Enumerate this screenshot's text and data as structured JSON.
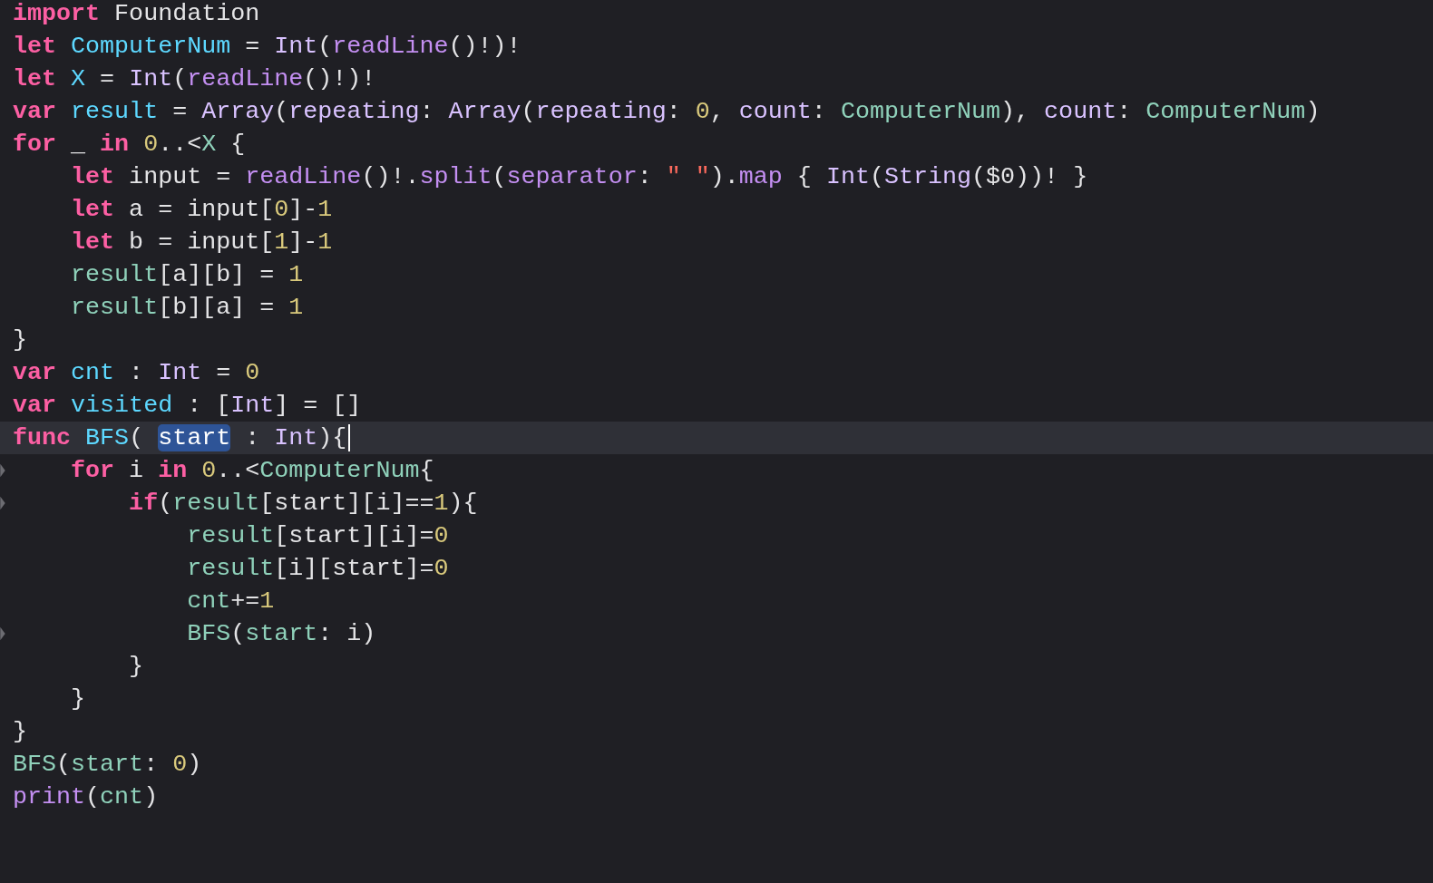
{
  "editor": {
    "lines": [
      {
        "current": false,
        "cursor": false,
        "fold_marker": false,
        "tokens": [
          {
            "kind": "keyword",
            "text": "import"
          },
          {
            "kind": "plain",
            "text": " Foundation"
          }
        ]
      },
      {
        "current": false,
        "cursor": false,
        "fold_marker": false,
        "tokens": [
          {
            "kind": "keyword",
            "text": "let"
          },
          {
            "kind": "decl",
            "text": " ComputerNum"
          },
          {
            "kind": "plain",
            "text": " = "
          },
          {
            "kind": "type",
            "text": "Int"
          },
          {
            "kind": "plain",
            "text": "("
          },
          {
            "kind": "system",
            "text": "readLine"
          },
          {
            "kind": "plain",
            "text": "()!)!"
          }
        ]
      },
      {
        "current": false,
        "cursor": false,
        "fold_marker": false,
        "tokens": [
          {
            "kind": "keyword",
            "text": "let"
          },
          {
            "kind": "decl",
            "text": " X"
          },
          {
            "kind": "plain",
            "text": " = "
          },
          {
            "kind": "type",
            "text": "Int"
          },
          {
            "kind": "plain",
            "text": "("
          },
          {
            "kind": "system",
            "text": "readLine"
          },
          {
            "kind": "plain",
            "text": "()!)!"
          }
        ]
      },
      {
        "current": false,
        "cursor": false,
        "fold_marker": false,
        "tokens": [
          {
            "kind": "keyword",
            "text": "var"
          },
          {
            "kind": "decl",
            "text": " result"
          },
          {
            "kind": "plain",
            "text": " = "
          },
          {
            "kind": "type",
            "text": "Array"
          },
          {
            "kind": "plain",
            "text": "("
          },
          {
            "kind": "type",
            "text": "repeating"
          },
          {
            "kind": "plain",
            "text": ": "
          },
          {
            "kind": "type",
            "text": "Array"
          },
          {
            "kind": "plain",
            "text": "("
          },
          {
            "kind": "type",
            "text": "repeating"
          },
          {
            "kind": "plain",
            "text": ": "
          },
          {
            "kind": "number",
            "text": "0"
          },
          {
            "kind": "plain",
            "text": ", "
          },
          {
            "kind": "type",
            "text": "count"
          },
          {
            "kind": "plain",
            "text": ": "
          },
          {
            "kind": "project",
            "text": "ComputerNum"
          },
          {
            "kind": "plain",
            "text": "), "
          },
          {
            "kind": "type",
            "text": "count"
          },
          {
            "kind": "plain",
            "text": ": "
          },
          {
            "kind": "project",
            "text": "ComputerNum"
          },
          {
            "kind": "plain",
            "text": ")"
          }
        ]
      },
      {
        "current": false,
        "cursor": false,
        "fold_marker": false,
        "tokens": [
          {
            "kind": "keyword",
            "text": "for"
          },
          {
            "kind": "plain",
            "text": " _ "
          },
          {
            "kind": "keyword",
            "text": "in"
          },
          {
            "kind": "number",
            "text": " 0"
          },
          {
            "kind": "plain",
            "text": "..<"
          },
          {
            "kind": "project",
            "text": "X"
          },
          {
            "kind": "plain",
            "text": " {"
          }
        ]
      },
      {
        "current": false,
        "cursor": false,
        "fold_marker": false,
        "tokens": [
          {
            "kind": "keyword",
            "text": "    let"
          },
          {
            "kind": "plain",
            "text": " input = "
          },
          {
            "kind": "system",
            "text": "readLine"
          },
          {
            "kind": "plain",
            "text": "()!."
          },
          {
            "kind": "system",
            "text": "split"
          },
          {
            "kind": "plain",
            "text": "("
          },
          {
            "kind": "system",
            "text": "separator"
          },
          {
            "kind": "plain",
            "text": ": "
          },
          {
            "kind": "string",
            "text": "\" \""
          },
          {
            "kind": "plain",
            "text": ")."
          },
          {
            "kind": "system",
            "text": "map"
          },
          {
            "kind": "plain",
            "text": " { "
          },
          {
            "kind": "type",
            "text": "Int"
          },
          {
            "kind": "plain",
            "text": "("
          },
          {
            "kind": "type",
            "text": "String"
          },
          {
            "kind": "plain",
            "text": "($0))! }"
          }
        ]
      },
      {
        "current": false,
        "cursor": false,
        "fold_marker": false,
        "tokens": [
          {
            "kind": "keyword",
            "text": "    let"
          },
          {
            "kind": "plain",
            "text": " a = input["
          },
          {
            "kind": "number",
            "text": "0"
          },
          {
            "kind": "plain",
            "text": "]-"
          },
          {
            "kind": "number",
            "text": "1"
          }
        ]
      },
      {
        "current": false,
        "cursor": false,
        "fold_marker": false,
        "tokens": [
          {
            "kind": "keyword",
            "text": "    let"
          },
          {
            "kind": "plain",
            "text": " b = input["
          },
          {
            "kind": "number",
            "text": "1"
          },
          {
            "kind": "plain",
            "text": "]-"
          },
          {
            "kind": "number",
            "text": "1"
          }
        ]
      },
      {
        "current": false,
        "cursor": false,
        "fold_marker": false,
        "tokens": [
          {
            "kind": "project",
            "text": "    result"
          },
          {
            "kind": "plain",
            "text": "[a][b] = "
          },
          {
            "kind": "number",
            "text": "1"
          }
        ]
      },
      {
        "current": false,
        "cursor": false,
        "fold_marker": false,
        "tokens": [
          {
            "kind": "project",
            "text": "    result"
          },
          {
            "kind": "plain",
            "text": "[b][a] = "
          },
          {
            "kind": "number",
            "text": "1"
          }
        ]
      },
      {
        "current": false,
        "cursor": false,
        "fold_marker": false,
        "tokens": [
          {
            "kind": "plain",
            "text": "}"
          }
        ]
      },
      {
        "current": false,
        "cursor": false,
        "fold_marker": false,
        "tokens": [
          {
            "kind": "keyword",
            "text": "var"
          },
          {
            "kind": "decl",
            "text": " cnt"
          },
          {
            "kind": "plain",
            "text": " : "
          },
          {
            "kind": "type",
            "text": "Int"
          },
          {
            "kind": "plain",
            "text": " = "
          },
          {
            "kind": "number",
            "text": "0"
          }
        ]
      },
      {
        "current": false,
        "cursor": false,
        "fold_marker": false,
        "tokens": [
          {
            "kind": "keyword",
            "text": "var"
          },
          {
            "kind": "decl",
            "text": " visited"
          },
          {
            "kind": "plain",
            "text": " : ["
          },
          {
            "kind": "type",
            "text": "Int"
          },
          {
            "kind": "plain",
            "text": "] = []"
          }
        ]
      },
      {
        "current": true,
        "cursor": true,
        "fold_marker": false,
        "tokens": [
          {
            "kind": "keyword",
            "text": "func"
          },
          {
            "kind": "decl",
            "text": " BFS"
          },
          {
            "kind": "plain",
            "text": "( "
          },
          {
            "kind": "highlighted",
            "text": "start"
          },
          {
            "kind": "plain",
            "text": " : "
          },
          {
            "kind": "type",
            "text": "Int"
          },
          {
            "kind": "plain",
            "text": "){"
          }
        ]
      },
      {
        "current": false,
        "cursor": false,
        "fold_marker": true,
        "tokens": [
          {
            "kind": "keyword",
            "text": "    for"
          },
          {
            "kind": "plain",
            "text": " i "
          },
          {
            "kind": "keyword",
            "text": "in"
          },
          {
            "kind": "number",
            "text": " 0"
          },
          {
            "kind": "plain",
            "text": "..<"
          },
          {
            "kind": "project",
            "text": "ComputerNum"
          },
          {
            "kind": "plain",
            "text": "{"
          }
        ]
      },
      {
        "current": false,
        "cursor": false,
        "fold_marker": true,
        "tokens": [
          {
            "kind": "keyword",
            "text": "        if"
          },
          {
            "kind": "plain",
            "text": "("
          },
          {
            "kind": "project",
            "text": "result"
          },
          {
            "kind": "plain",
            "text": "[start][i]=="
          },
          {
            "kind": "number",
            "text": "1"
          },
          {
            "kind": "plain",
            "text": "){"
          }
        ]
      },
      {
        "current": false,
        "cursor": false,
        "fold_marker": false,
        "tokens": [
          {
            "kind": "project",
            "text": "            result"
          },
          {
            "kind": "plain",
            "text": "[start][i]="
          },
          {
            "kind": "number",
            "text": "0"
          }
        ]
      },
      {
        "current": false,
        "cursor": false,
        "fold_marker": false,
        "tokens": [
          {
            "kind": "project",
            "text": "            result"
          },
          {
            "kind": "plain",
            "text": "[i][start]="
          },
          {
            "kind": "number",
            "text": "0"
          }
        ]
      },
      {
        "current": false,
        "cursor": false,
        "fold_marker": false,
        "tokens": [
          {
            "kind": "project",
            "text": "            cnt"
          },
          {
            "kind": "plain",
            "text": "+="
          },
          {
            "kind": "number",
            "text": "1"
          }
        ]
      },
      {
        "current": false,
        "cursor": false,
        "fold_marker": true,
        "tokens": [
          {
            "kind": "project",
            "text": "            BFS"
          },
          {
            "kind": "plain",
            "text": "("
          },
          {
            "kind": "project",
            "text": "start"
          },
          {
            "kind": "plain",
            "text": ": i)"
          }
        ]
      },
      {
        "current": false,
        "cursor": false,
        "fold_marker": false,
        "tokens": [
          {
            "kind": "plain",
            "text": "        }"
          }
        ]
      },
      {
        "current": false,
        "cursor": false,
        "fold_marker": false,
        "tokens": [
          {
            "kind": "plain",
            "text": "    }"
          }
        ]
      },
      {
        "current": false,
        "cursor": false,
        "fold_marker": false,
        "tokens": [
          {
            "kind": "plain",
            "text": "}"
          }
        ]
      },
      {
        "current": false,
        "cursor": false,
        "fold_marker": false,
        "tokens": [
          {
            "kind": "project",
            "text": "BFS"
          },
          {
            "kind": "plain",
            "text": "("
          },
          {
            "kind": "project",
            "text": "start"
          },
          {
            "kind": "plain",
            "text": ": "
          },
          {
            "kind": "number",
            "text": "0"
          },
          {
            "kind": "plain",
            "text": ")"
          }
        ]
      },
      {
        "current": false,
        "cursor": false,
        "fold_marker": false,
        "tokens": [
          {
            "kind": "system",
            "text": "print"
          },
          {
            "kind": "plain",
            "text": "("
          },
          {
            "kind": "project",
            "text": "cnt"
          },
          {
            "kind": "plain",
            "text": ")"
          }
        ]
      }
    ]
  }
}
